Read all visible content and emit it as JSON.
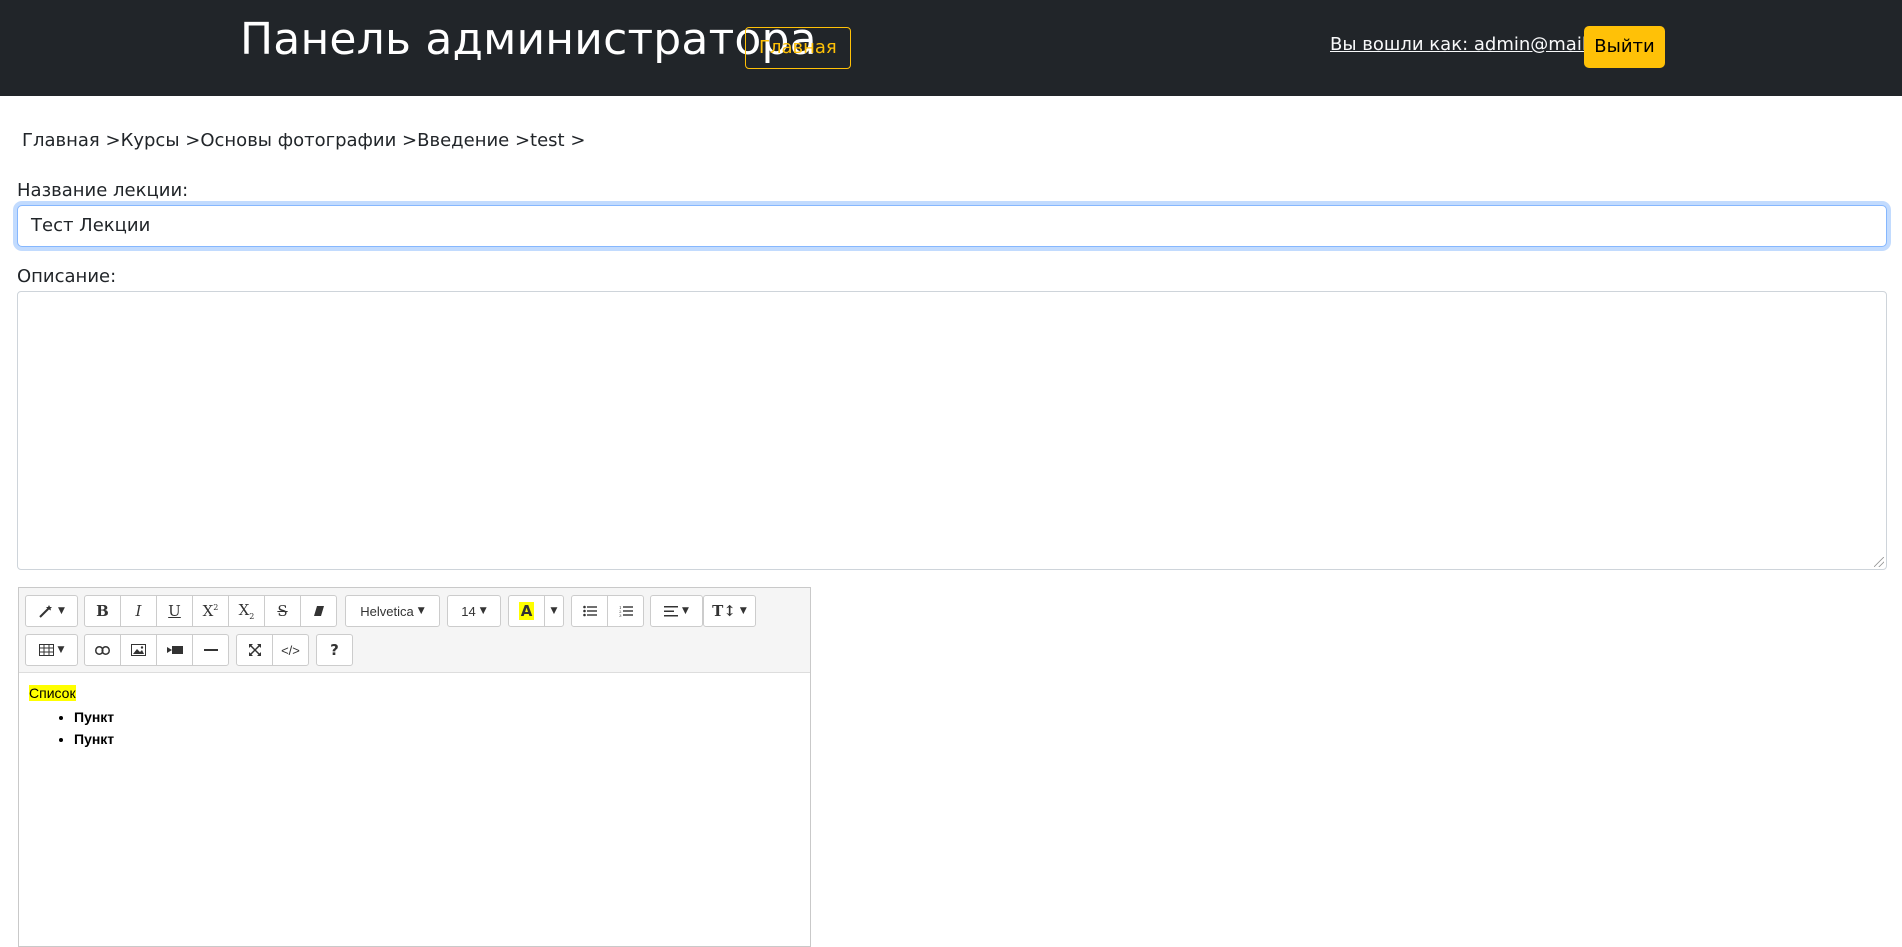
{
  "header": {
    "brand": "Панель администратора",
    "home_button": "Главная",
    "user_link": "Вы вошли как: admin@mail.ru",
    "logout_button": "Выйти"
  },
  "breadcrumb": [
    "Главная >",
    "Курсы >",
    "Основы фотографии >",
    "Введение >",
    "test >"
  ],
  "form": {
    "title_label": "Название лекции:",
    "title_value": "Тест Лекции",
    "description_label": "Описание:",
    "description_value": ""
  },
  "editor": {
    "toolbar": {
      "font_name": "Helvetica",
      "font_size": "14",
      "color_button": "A",
      "help_button": "?"
    },
    "content": {
      "highlighted_text": "Список",
      "highlight_color": "#ffff00",
      "list_items": [
        "Пункт",
        "Пункт"
      ]
    }
  },
  "colors": {
    "navbar": "#212529",
    "accent": "#ffc107"
  }
}
